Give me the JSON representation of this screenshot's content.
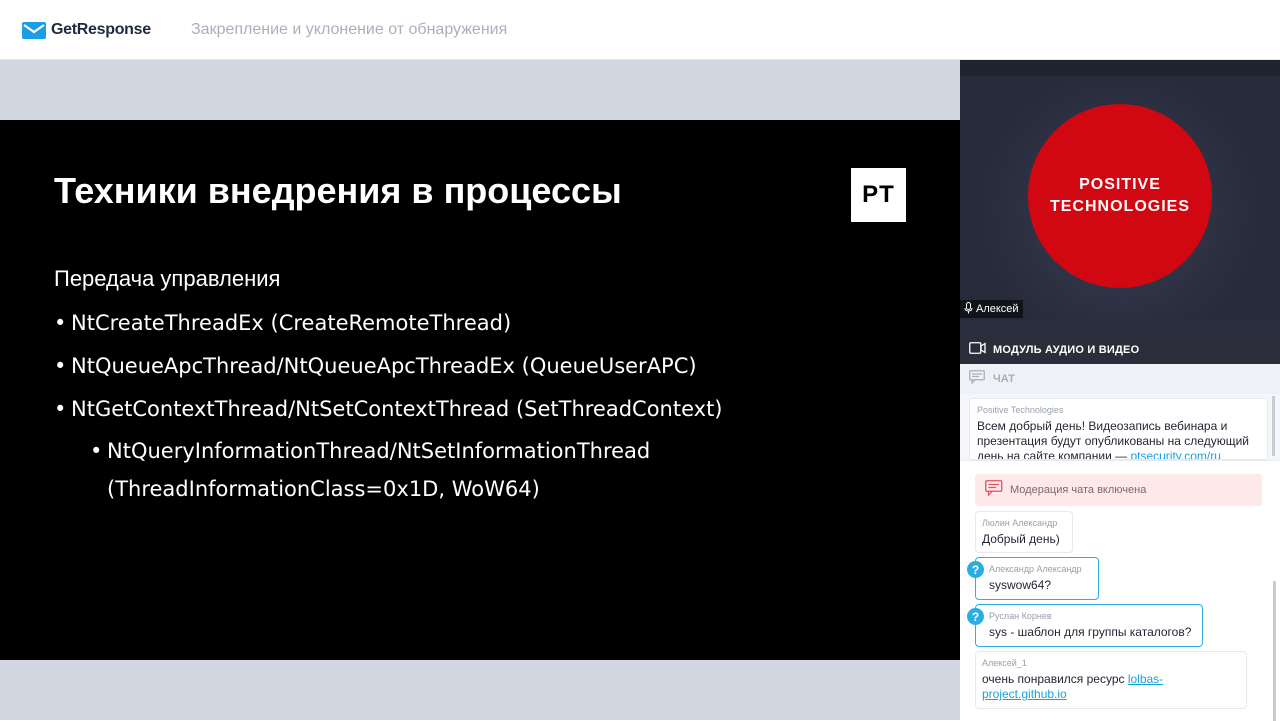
{
  "header": {
    "brand": "GetResponse",
    "title": "Закрепление и уклонение от обнаружения",
    "brand_color": "#1a9ee6"
  },
  "slide": {
    "title": "Техники внедрения в процессы",
    "logo_text": "PT",
    "subtitle": "Передача управления",
    "bullets": [
      "NtCreateThreadEx (CreateRemoteThread)",
      "NtQueueApcThread/NtQueueApcThreadEx (QueueUserAPC)",
      "NtGetContextThread/NtSetContextThread (SetThreadContext)"
    ],
    "sub_bullet_line1": "NtQueryInformationThread/NtSetInformationThread",
    "sub_bullet_line2": "(ThreadInformationClass=0x1D, WoW64)"
  },
  "video": {
    "logo_line1": "POSITIVE",
    "logo_line2": "TECHNOLOGIES",
    "speaker": "Алексей",
    "module_label": "МОДУЛЬ АУДИО И ВИДЕО"
  },
  "chat": {
    "label": "ЧАТ",
    "pinned": {
      "author": "Positive Technologies",
      "text": "Всем добрый день! Видеозапись вебинара и презентация будут опубликованы на следующий день на сайте компании — ",
      "link": "ptsecurity.com/ru"
    },
    "moderation": "Модерация чата включена",
    "messages": [
      {
        "author": "Люлин Александр",
        "text": "Добрый день)"
      },
      {
        "author": "Александр Александр",
        "text": "syswow64?"
      },
      {
        "author": "Руслан Корнев",
        "text": "sys - шаблон для группы каталогов?"
      },
      {
        "author": "Алексей_1",
        "text": "очень понравился ресурс ",
        "link": "lolbas-project.github.io"
      }
    ]
  }
}
